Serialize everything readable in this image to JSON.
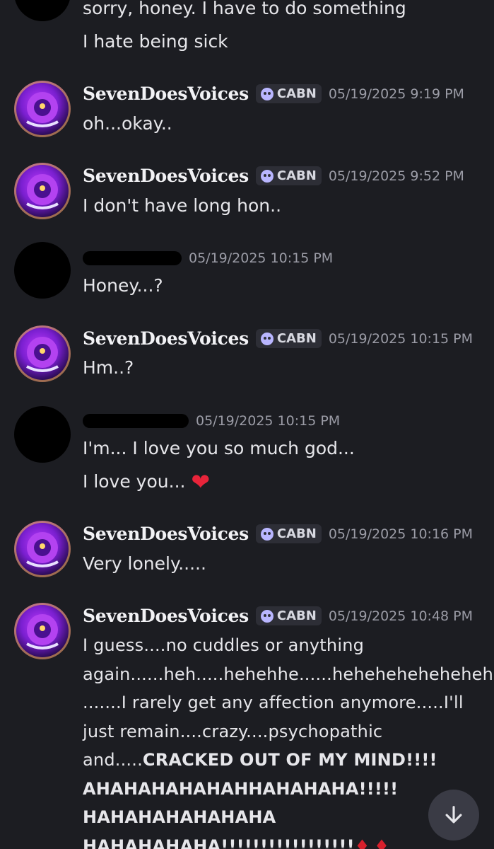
{
  "messages": [
    {
      "lines": [
        "sorry, honey. I have to do something",
        "I hate being sick"
      ]
    },
    {
      "user": "SevenDoesVoices",
      "tag": "CABN",
      "time": "05/19/2025 9:19 PM",
      "lines": [
        "oh...okay.."
      ]
    },
    {
      "user": "SevenDoesVoices",
      "tag": "CABN",
      "time": "05/19/2025 9:52 PM",
      "lines": [
        "I don't have long hon.."
      ]
    },
    {
      "time": "05/19/2025 10:15 PM",
      "lines": [
        "Honey...?"
      ]
    },
    {
      "user": "SevenDoesVoices",
      "tag": "CABN",
      "time": "05/19/2025 10:15 PM",
      "lines": [
        "Hm..?"
      ]
    },
    {
      "time": "05/19/2025 10:15 PM",
      "lines": [
        "I'm... I love you so much god...",
        "I love you..."
      ]
    },
    {
      "user": "SevenDoesVoices",
      "tag": "CABN",
      "time": "05/19/2025 10:16 PM",
      "lines": [
        "Very lonely....."
      ]
    },
    {
      "user": "SevenDoesVoices",
      "tag": "CABN",
      "time": "05/19/2025 10:48 PM",
      "lines": [
        "I guess....no cuddles or anything",
        "again......heh.....hehehhe......heheheheheheheh",
        ".......I rarely get any affection anymore.....I'll",
        "just remain....crazy....psychopathic",
        "and....."
      ],
      "bold": [
        "CRACKED OUT OF MY MIND!!!!",
        "AHAHAHAHAHAHHAHAHAHA!!!!!",
        "HAHAHAHAHAHAHA",
        "HAHAHAHAHA!!!!!!!!!!!!!!!!!"
      ]
    }
  ],
  "icons": {
    "reaction": "heart-emoji",
    "scroll": "arrow-down-icon"
  },
  "colors": {
    "background": "#1c1d22",
    "heart": "#e8243a"
  }
}
